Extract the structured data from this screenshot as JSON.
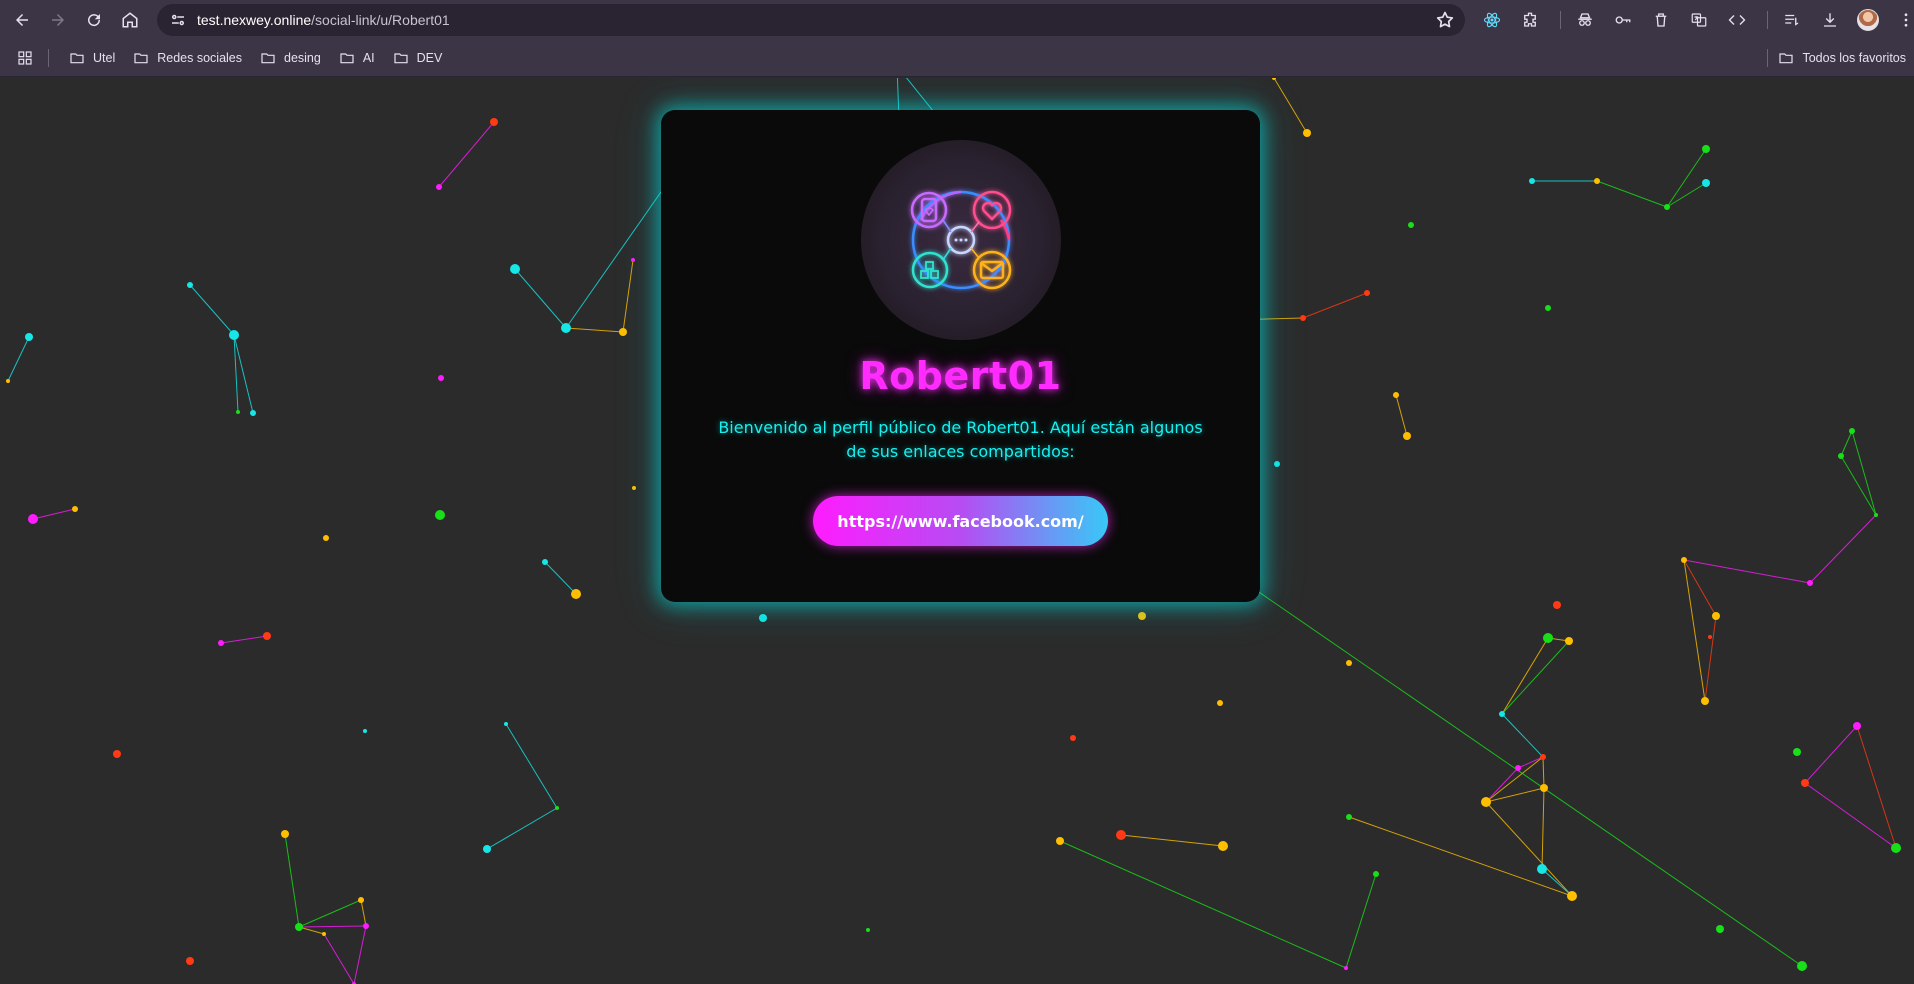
{
  "browser": {
    "url_host": "test.nexwey.online",
    "url_path": "/social-link/u/Robert01",
    "bookmarks": [
      "Utel",
      "Redes sociales",
      "desing",
      "AI",
      "DEV"
    ],
    "all_bookmarks_label": "Todos los favoritos"
  },
  "profile": {
    "username": "Robert01",
    "welcome_text": "Bienvenido al perfil público de Robert01. Aquí están algunos de sus enlaces compartidos:",
    "links": [
      "https://www.facebook.com/"
    ]
  },
  "colors": {
    "accent_magenta": "#ff2bff",
    "accent_cyan": "#19f0f0",
    "page_background": "#2b2b2b",
    "card_background": "#0a0a0a"
  }
}
